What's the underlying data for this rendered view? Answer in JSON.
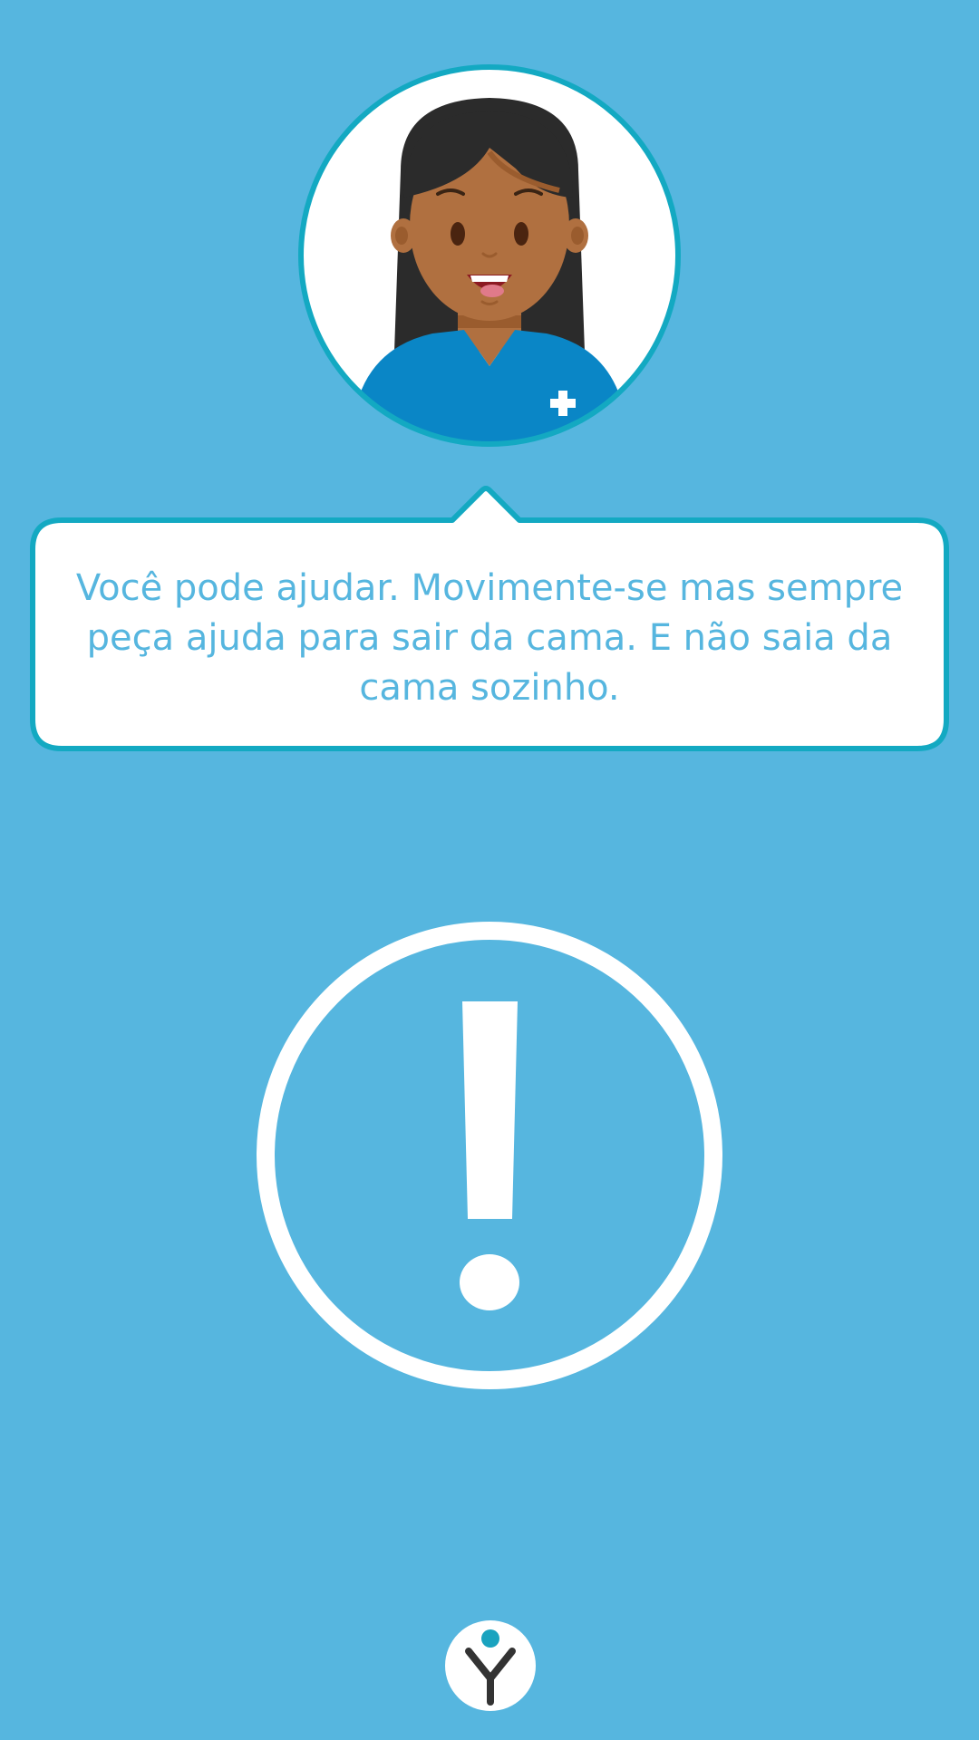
{
  "screen": {
    "background_color": "#56b6df"
  },
  "avatar": {
    "icon": "nurse-avatar-icon",
    "ring_color": "#13a9c2",
    "uniform_color": "#0a86c6"
  },
  "speech_bubble": {
    "message": "Você pode ajudar. Movimente-se mas sempre peça ajuda para sair da cama. E não saia da cama sozinho.",
    "border_color": "#13a9c2",
    "text_color": "#56b6df"
  },
  "alert": {
    "icon": "exclamation-warning-icon"
  },
  "footer": {
    "logo_icon": "brand-logo-icon",
    "logo_dot_color": "#1aa3bf",
    "logo_mark_color": "#333333"
  }
}
